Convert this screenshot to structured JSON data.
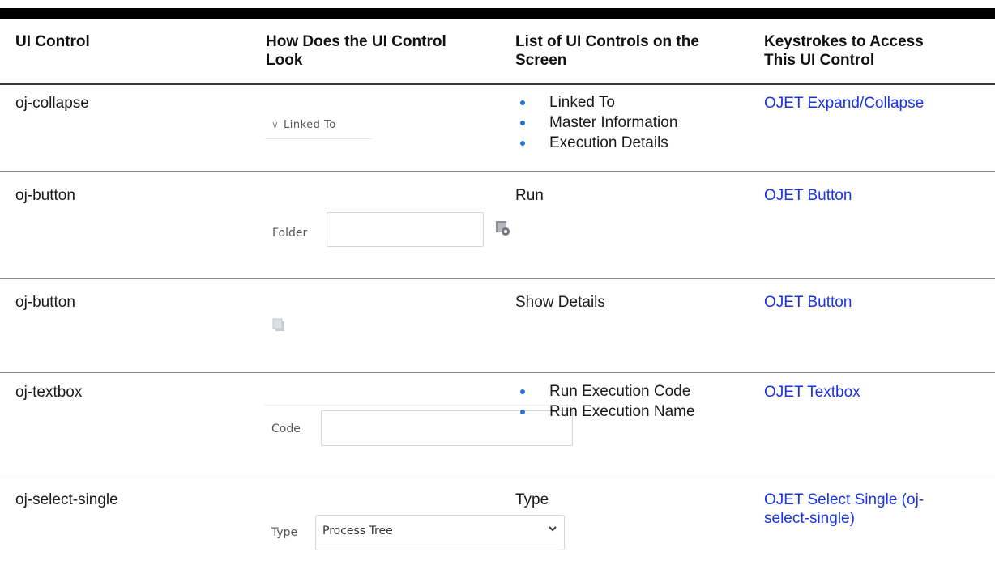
{
  "table": {
    "headers": {
      "col1": "UI Control",
      "col2_line1": "How Does the UI Control",
      "col2_line2": "Look",
      "col3_line1": "List of UI Controls on the",
      "col3_line2": "Screen",
      "col4_line1": "Keystrokes to Access",
      "col4_line2": "This UI Control"
    },
    "rows": [
      {
        "control": "oj-collapse",
        "preview_label": "Linked To",
        "list": [
          "Linked To",
          "Master Information",
          "Execution Details"
        ],
        "keystroke_link": "OJET Expand/Collapse"
      },
      {
        "control": "oj-button",
        "preview_label": "Folder",
        "list_text": "Run",
        "keystroke_link": "OJET Button"
      },
      {
        "control": "oj-button",
        "list_text": "Show Details",
        "keystroke_link": "OJET Button"
      },
      {
        "control": "oj-textbox",
        "preview_label": "Code",
        "list": [
          "Run Execution Code",
          "Run Execution Name"
        ],
        "keystroke_link": "OJET Textbox"
      },
      {
        "control": "oj-select-single",
        "preview_label": "Type",
        "preview_value": "Process Tree",
        "list_text": "Type",
        "keystroke_link_line1": "OJET Select Single (oj-",
        "keystroke_link_line2": "select-single)"
      }
    ]
  },
  "colors": {
    "link": "#1a33e6",
    "bullet": "#2a6fd6",
    "header_bar": "#000000"
  },
  "icons": {
    "folder_button": "folder-settings-icon",
    "details_button": "copy-pages-icon",
    "collapse_toggle": "chevron-down-icon",
    "select_arrow": "chevron-down-icon"
  }
}
